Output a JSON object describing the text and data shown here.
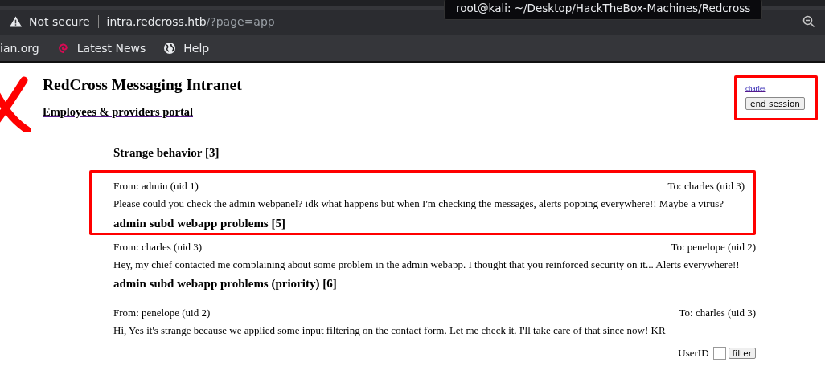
{
  "browser": {
    "security_label": "Not secure",
    "url_host": "intra.redcross.htb",
    "url_path": "/?page=app",
    "bookmarks": [
      {
        "label": "ian.org"
      },
      {
        "label": "Latest News"
      },
      {
        "label": "Help"
      }
    ],
    "tooltip": "root@kali: ~/Desktop/HackTheBox-Machines/Redcross"
  },
  "page": {
    "title": "RedCross Messaging Intranet",
    "subtitle": "Employees & providers portal",
    "user": {
      "name": "charles",
      "button": "end session",
      "highlighted": true
    },
    "entries": [
      {
        "kind": "subject",
        "text": "Strange behavior [3]",
        "highlighted": false
      },
      {
        "kind": "message",
        "from": "From: admin (uid 1)",
        "to": "To: charles (uid 3)",
        "body": "Please could you check the admin webpanel? idk what happens but when I'm checking the messages, alerts popping everywhere!! Maybe a virus?",
        "highlighted": true
      },
      {
        "kind": "subject",
        "text": "admin subd webapp problems [5]",
        "highlighted": true
      },
      {
        "kind": "message",
        "from": "From: charles (uid 3)",
        "to": "To: penelope (uid 2)",
        "body": "Hey, my chief contacted me complaining about some problem in the admin webapp. I thought that you reinforced security on it... Alerts everywhere!!",
        "highlighted": false
      },
      {
        "kind": "subject",
        "text": "admin subd webapp problems (priority) [6]",
        "highlighted": false
      },
      {
        "kind": "message",
        "from": "From: penelope (uid 2)",
        "to": "To: charles (uid 3)",
        "body": "Hi, Yes it's strange because we applied some input filtering on the contact form. Let me check it. I'll take care of that since now! KR",
        "highlighted": false
      }
    ],
    "filter": {
      "label": "UserID",
      "button": "filter"
    }
  }
}
